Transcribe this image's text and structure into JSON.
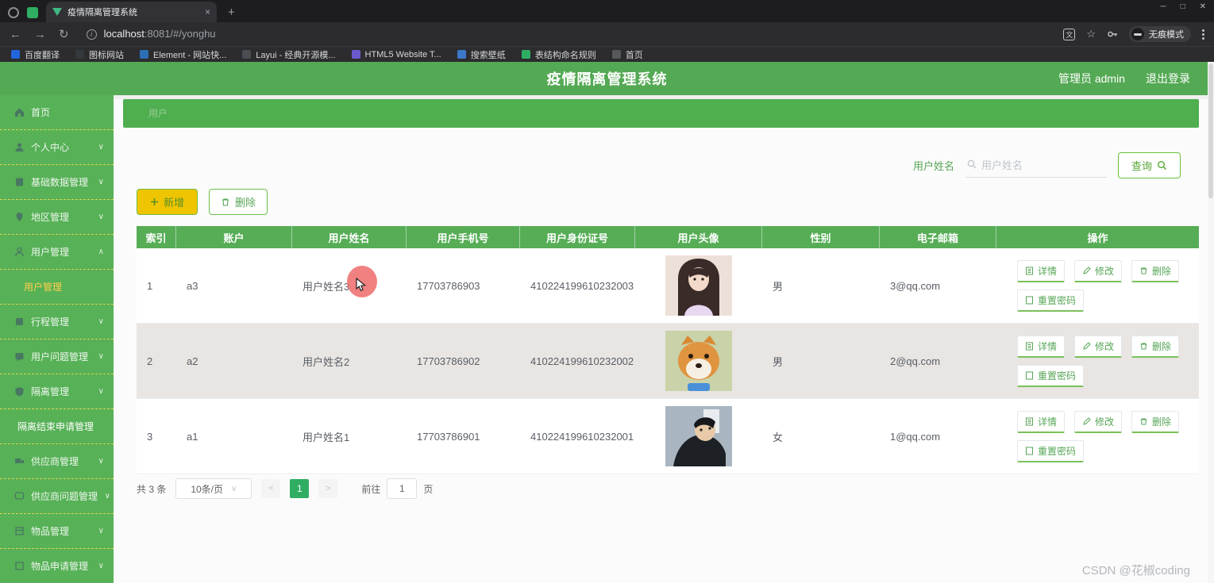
{
  "browser": {
    "tab": {
      "title": "疫情隔离管理系统",
      "close": "×",
      "new_tab": "+"
    },
    "window_controls": {
      "minimize": "─",
      "maximize": "□",
      "close": "✕"
    },
    "nav": {
      "back": "←",
      "forward": "→",
      "reload": "↻"
    },
    "url": {
      "host": "localhost",
      "rest": ":8081/#/yonghu"
    },
    "incognito_label": "无痕模式",
    "bookmarks": [
      {
        "label": "百度翻译"
      },
      {
        "label": "图标网站"
      },
      {
        "label": "Element - 网站快..."
      },
      {
        "label": "Layui - 经典开源模..."
      },
      {
        "label": "HTML5 Website T..."
      },
      {
        "label": "搜索壁纸"
      },
      {
        "label": "表结构命名规则"
      },
      {
        "label": "首页"
      }
    ]
  },
  "header": {
    "title": "疫情隔离管理系统",
    "user": "管理员 admin",
    "logout": "退出登录"
  },
  "sidebar": {
    "items": [
      {
        "label": "首页"
      },
      {
        "label": "个人中心"
      },
      {
        "label": "基础数据管理"
      },
      {
        "label": "地区管理"
      },
      {
        "label": "用户管理"
      },
      {
        "label": "用户管理",
        "submenu": true,
        "active": true
      },
      {
        "label": "行程管理"
      },
      {
        "label": "用户问题管理"
      },
      {
        "label": "隔离管理"
      },
      {
        "label": "隔离结束申请管理",
        "submenu": true
      },
      {
        "label": "供应商管理"
      },
      {
        "label": "供应商问题管理"
      },
      {
        "label": "物品管理"
      },
      {
        "label": "物品申请管理"
      }
    ]
  },
  "banner": {
    "text": "用户"
  },
  "search": {
    "label": "用户姓名",
    "placeholder": "用户姓名",
    "query_label": "查询"
  },
  "toolbar": {
    "add_label": "新增",
    "delete_label": "删除"
  },
  "table": {
    "columns": [
      "索引",
      "账户",
      "用户姓名",
      "用户手机号",
      "用户身份证号",
      "用户头像",
      "性别",
      "电子邮箱",
      "操作"
    ],
    "actions": {
      "detail": "详情",
      "edit": "修改",
      "delete": "删除",
      "reset": "重置密码"
    },
    "rows": [
      {
        "index": "1",
        "account": "a3",
        "name": "用户姓名3",
        "phone": "17703786903",
        "id_card": "410224199610232003",
        "avatar": "anime-girl-photo",
        "gender": "男",
        "email": "3@qq.com"
      },
      {
        "index": "2",
        "account": "a2",
        "name": "用户姓名2",
        "phone": "17703786902",
        "id_card": "410224199610232002",
        "avatar": "shiba-dog-photo",
        "gender": "男",
        "email": "2@qq.com"
      },
      {
        "index": "3",
        "account": "a1",
        "name": "用户姓名1",
        "phone": "17703786901",
        "id_card": "410224199610232001",
        "avatar": "young-man-photo",
        "gender": "女",
        "email": "1@qq.com"
      }
    ]
  },
  "pagination": {
    "total": "共 3 条",
    "page_size": "10条/页",
    "prev": "<",
    "current_page": "1",
    "next": ">",
    "goto_label": "前往",
    "goto_value": "1",
    "goto_unit": "页"
  },
  "watermark": "CSDN @花椒coding",
  "colors": {
    "header_green": "#54a954",
    "sidebar_green": "#57b157",
    "table_header_green": "#56ad56",
    "active_submenu_yellow": "#ffd04b",
    "add_button_gold": "#eec500",
    "active_page_green": "#2fae63",
    "highlight_red": "#ef6b6b"
  }
}
